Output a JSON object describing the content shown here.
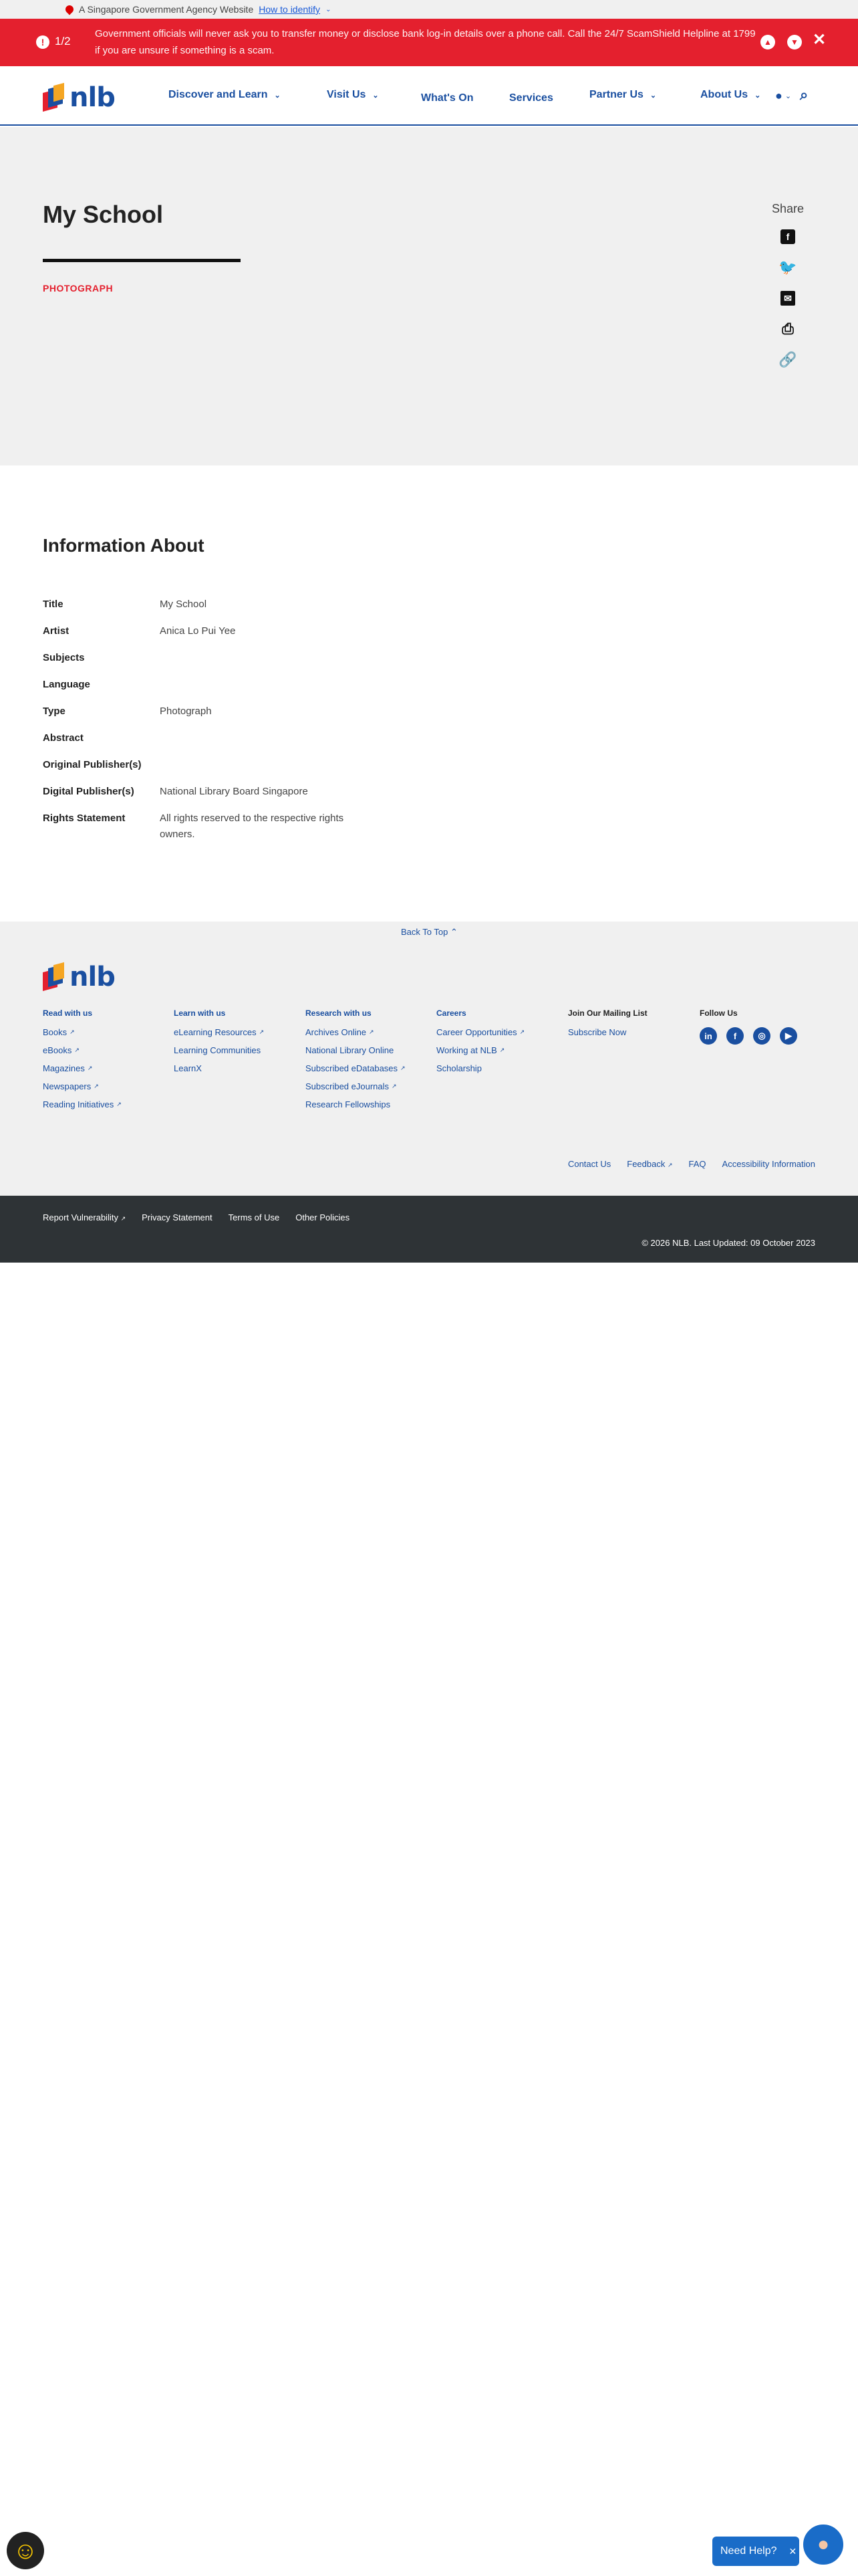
{
  "masthead": {
    "text": "A Singapore Government Agency Website",
    "link": "How to identify"
  },
  "alert": {
    "counter": "1/2",
    "message": "Government officials will never ask you to transfer money or disclose bank log-in details over a phone call. Call the 24/7 ScamShield Helpline at 1799 if you are unsure if something is a scam."
  },
  "header": {
    "logo": "nlb",
    "nav": [
      {
        "label": "Discover and Learn"
      },
      {
        "label": "Visit Us"
      },
      {
        "label": "What's On"
      },
      {
        "label": "Services"
      },
      {
        "label": "Partner Us"
      },
      {
        "label": "About Us"
      }
    ]
  },
  "hero": {
    "title": "My School",
    "type": "PHOTOGRAPH",
    "share_label": "Share"
  },
  "info": {
    "heading": "Information About",
    "rows": [
      {
        "key": "Title",
        "value": "My School"
      },
      {
        "key": "Artist",
        "value": "Anica Lo Pui Yee"
      },
      {
        "key": "Subjects",
        "value": ""
      },
      {
        "key": "Language",
        "value": ""
      },
      {
        "key": "Type",
        "value": "Photograph"
      },
      {
        "key": "Abstract",
        "value": ""
      },
      {
        "key": "Original Publisher(s)",
        "value": ""
      },
      {
        "key": "Digital Publisher(s)",
        "value": "National Library Board Singapore"
      },
      {
        "key": "Rights Statement",
        "value": "All rights reserved to the respective rights owners."
      }
    ]
  },
  "footer": {
    "back_to_top": "Back To Top",
    "cols": [
      {
        "title": "Read with us",
        "items": [
          "Books",
          "eBooks",
          "Magazines",
          "Newspapers",
          "Reading Initiatives"
        ]
      },
      {
        "title": "Learn with us",
        "items": [
          "eLearning Resources",
          "Learning Communities",
          "LearnX"
        ]
      },
      {
        "title": "Research with us",
        "items": [
          "Archives Online",
          "National Library Online",
          "Subscribed eDatabases",
          "Subscribed eJournals",
          "Research Fellowships"
        ]
      },
      {
        "title": "Careers",
        "items": [
          "Career Opportunities",
          "Working at NLB",
          "Scholarship"
        ]
      },
      {
        "title": "Join Our Mailing List",
        "items": [
          "Subscribe Now"
        ]
      },
      {
        "title": "Follow Us",
        "items": []
      }
    ],
    "links": [
      "Contact Us",
      "Feedback",
      "FAQ",
      "Accessibility Information"
    ],
    "policies": [
      "Report Vulnerability",
      "Privacy Statement",
      "Terms of Use",
      "Other Policies"
    ],
    "copyright": "© 2026 NLB. Last Updated: 09 October 2023"
  },
  "help": {
    "label": "Need Help?"
  }
}
